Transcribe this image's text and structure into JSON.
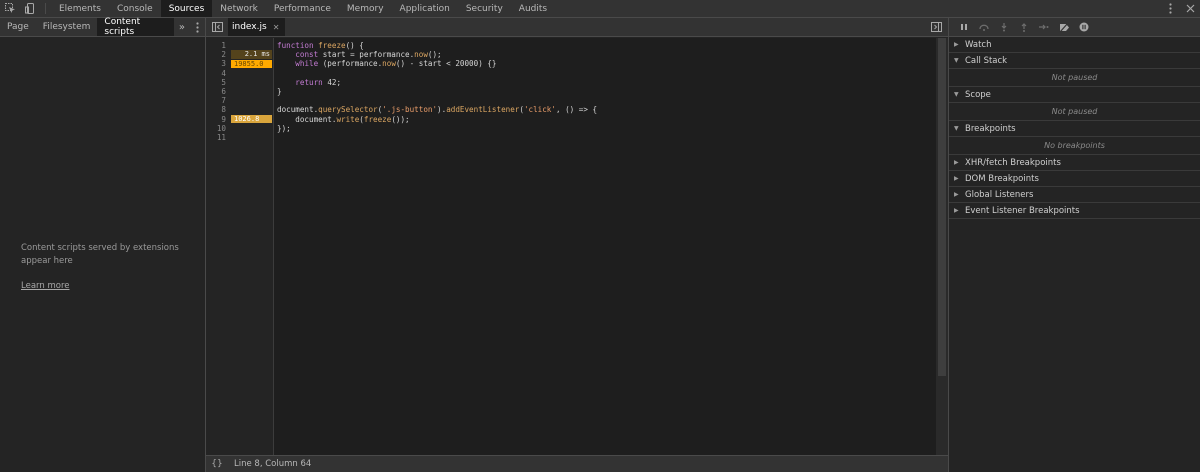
{
  "toolbar": {
    "tabs": [
      "Elements",
      "Console",
      "Sources",
      "Network",
      "Performance",
      "Memory",
      "Application",
      "Security",
      "Audits"
    ],
    "active_tab": "Sources"
  },
  "navigator": {
    "tabs": [
      "Page",
      "Filesystem",
      "Content scripts"
    ],
    "active_tab": "Content scripts",
    "more_label": "»",
    "message": "Content scripts served by extensions appear here",
    "link": "Learn more"
  },
  "editor": {
    "file_tab": "index.js",
    "lines": [
      {
        "n": "1",
        "perf": ""
      },
      {
        "n": "2",
        "perf": "2.1 ms"
      },
      {
        "n": "3",
        "perf": "19855.0"
      },
      {
        "n": "4",
        "perf": ""
      },
      {
        "n": "5",
        "perf": ""
      },
      {
        "n": "6",
        "perf": ""
      },
      {
        "n": "7",
        "perf": ""
      },
      {
        "n": "8",
        "perf": ""
      },
      {
        "n": "9",
        "perf": "1026.8"
      },
      {
        "n": "10",
        "perf": ""
      },
      {
        "n": "11",
        "perf": ""
      }
    ],
    "code": [
      "function freeze() {",
      "    const start = performance.now();",
      "    while (performance.now() - start < 20000) {}",
      "",
      "    return 42;",
      "}",
      "",
      "document.querySelector('.js-button').addEventListener('click', () => {",
      "    document.write(freeze());",
      "});",
      ""
    ],
    "status": "Line 8, Column 64",
    "format_label": "{}"
  },
  "debugger": {
    "sections": {
      "watch": "Watch",
      "call_stack": "Call Stack",
      "call_stack_body": "Not paused",
      "scope": "Scope",
      "scope_body": "Not paused",
      "breakpoints": "Breakpoints",
      "breakpoints_body": "No breakpoints",
      "xhr": "XHR/fetch Breakpoints",
      "dom": "DOM Breakpoints",
      "global": "Global Listeners",
      "event": "Event Listener Breakpoints"
    }
  }
}
